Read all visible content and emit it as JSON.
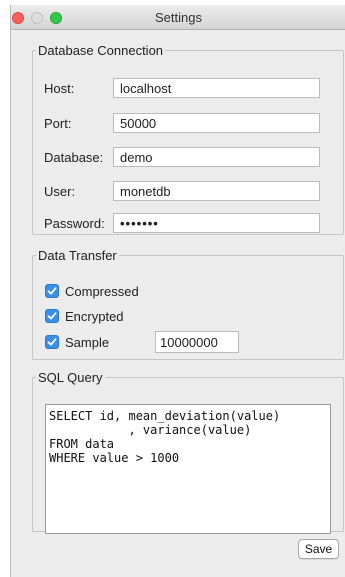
{
  "window": {
    "title": "Settings"
  },
  "database_connection": {
    "legend": "Database Connection",
    "fields": [
      {
        "label": "Host:",
        "value": "localhost"
      },
      {
        "label": "Port:",
        "value": "50000"
      },
      {
        "label": "Database:",
        "value": "demo"
      },
      {
        "label": "User:",
        "value": "monetdb"
      },
      {
        "label": "Password:",
        "value": "•••••••"
      }
    ]
  },
  "data_transfer": {
    "legend": "Data Transfer",
    "options": [
      {
        "label": "Compressed",
        "checked": true
      },
      {
        "label": "Encrypted",
        "checked": true
      },
      {
        "label": "Sample",
        "checked": true
      }
    ],
    "sample_value": "10000000"
  },
  "sql_query": {
    "legend": "SQL Query",
    "text": "SELECT id, mean_deviation(value)\n           , variance(value)\nFROM data\nWHERE value > 1000"
  },
  "buttons": {
    "save": "Save"
  },
  "colors": {
    "accent": "#3c8ee9",
    "close": "#fc605c",
    "zoom": "#34c84a"
  }
}
